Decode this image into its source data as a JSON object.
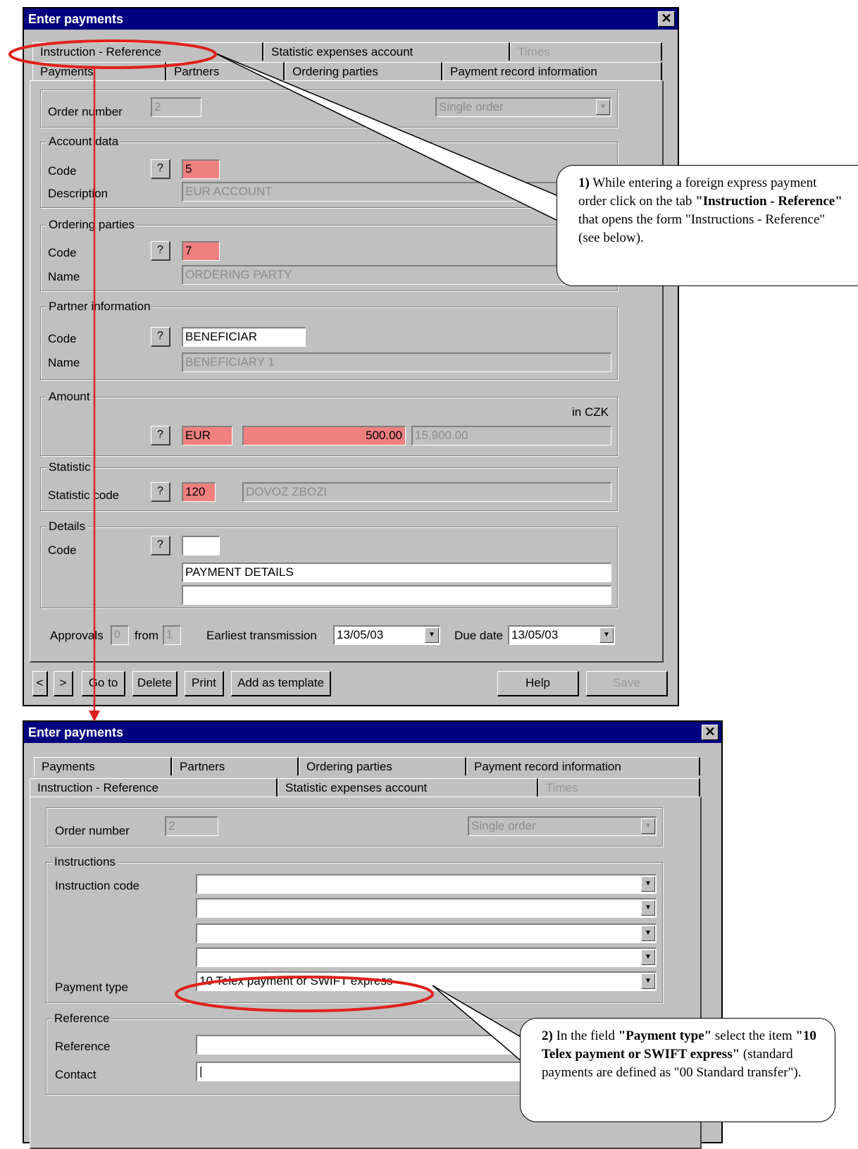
{
  "win1": {
    "title": "Enter payments",
    "close": "✕",
    "tabs_row1": [
      "Instruction - Reference",
      "Statistic expenses account",
      "Times"
    ],
    "tabs_row2": [
      "Payments",
      "Partners",
      "Ordering parties",
      "Payment record information"
    ],
    "order": {
      "label": "Order number",
      "value": "2",
      "type": "Single order"
    },
    "account": {
      "legend": "Account data",
      "code_label": "Code",
      "code": "5",
      "desc_label": "Description",
      "desc": "EUR ACCOUNT"
    },
    "ordering": {
      "legend": "Ordering parties",
      "code_label": "Code",
      "code": "7",
      "name_label": "Name",
      "name": "ORDERING PARTY"
    },
    "partner": {
      "legend": "Partner information",
      "code_label": "Code",
      "code": "BENEFICIAR",
      "name_label": "Name",
      "name": "BENEFICIARY 1"
    },
    "amount": {
      "legend": "Amount",
      "in_label": "in CZK",
      "currency": "EUR",
      "value": "500.00",
      "converted": "15,900.00"
    },
    "statistic": {
      "legend": "Statistic",
      "code_label": "Statistic code",
      "code": "120",
      "desc": "DOVOZ ZBOZI"
    },
    "details": {
      "legend": "Details",
      "code_label": "Code",
      "code": "",
      "line1": "PAYMENT DETAILS",
      "line2": ""
    },
    "bottom": {
      "approvals_label": "Approvals",
      "approvals": "0",
      "from_label": "from",
      "from": "1",
      "earliest_label": "Earliest transmission",
      "earliest": "13/05/03",
      "due_label": "Due date",
      "due": "13/05/03"
    },
    "qmark": "?",
    "buttons": {
      "prev": "<",
      "next": ">",
      "goto": "Go to",
      "delete": "Delete",
      "print": "Print",
      "template": "Add as template",
      "help": "Help",
      "save": "Save"
    }
  },
  "win2": {
    "title": "Enter payments",
    "close": "✕",
    "tabs_row1": [
      "Payments",
      "Partners",
      "Ordering parties",
      "Payment record information"
    ],
    "tabs_row2": [
      "Instruction - Reference",
      "Statistic expenses account",
      "Times"
    ],
    "order": {
      "label": "Order number",
      "value": "2",
      "type": "Single order"
    },
    "instructions": {
      "legend": "Instructions",
      "code_label": "Instruction code",
      "codes": [
        "",
        "",
        "",
        ""
      ],
      "type_label": "Payment type",
      "type": "10 Telex payment or SWIFT express"
    },
    "reference": {
      "legend": "Reference",
      "ref_label": "Reference",
      "ref": "",
      "contact_label": "Contact",
      "contact": "|"
    }
  },
  "callout1": {
    "num": "1)",
    "t1": " While entering a foreign express payment order click on the tab ",
    "b1": "\"Instruction - Reference\"",
    "t2": " that opens the form \"Instructions - Reference\" (see below)."
  },
  "callout2": {
    "num": "2)",
    "t1": " In the field ",
    "b1": "\"Payment type\"",
    "t2": " select the item ",
    "b2": "\"10 Telex payment or SWIFT express\"",
    "t3": " (standard payments are defined as \"00 Standard transfer\")."
  },
  "colors": {
    "title_bar": "#000080",
    "window": "#c0c0c0",
    "required": "#f08080",
    "annotation": "#e0201c"
  }
}
